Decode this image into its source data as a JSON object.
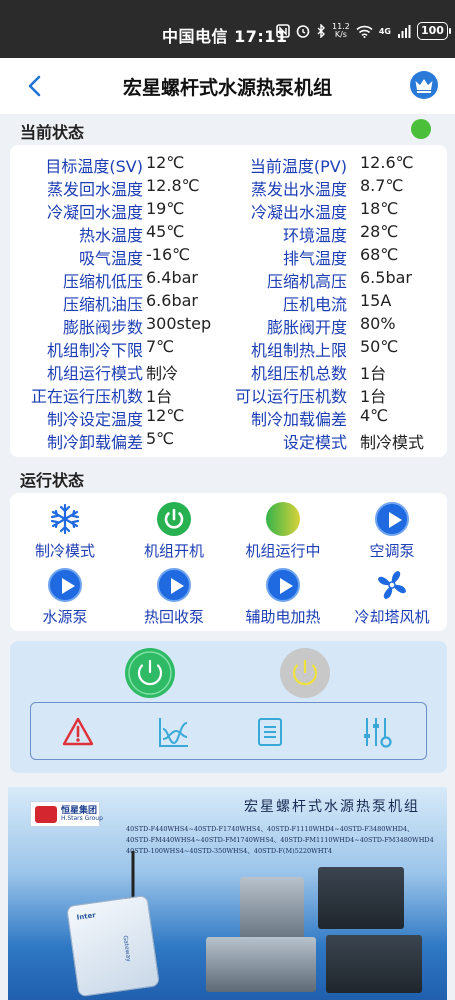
{
  "status_bar": {
    "carrier_time": "中国电信 17:11",
    "net_speed_value": "11.2",
    "net_speed_unit": "K/s",
    "network": "4G",
    "battery": "100"
  },
  "header": {
    "title": "宏星螺杆式水源热泵机组",
    "back_icon": "chevron-left-icon",
    "crown_icon": "crown-icon"
  },
  "current_state": {
    "heading": "当前状态",
    "indicator_color": "#4cbf3a",
    "rows": [
      {
        "l1": "目标温度(SV)",
        "v1": "12℃",
        "l2": "当前温度(PV)",
        "v2": "12.6℃"
      },
      {
        "l1": "蒸发回水温度",
        "v1": "12.8℃",
        "l2": "蒸发出水温度",
        "v2": "8.7℃"
      },
      {
        "l1": "冷凝回水温度",
        "v1": "19℃",
        "l2": "冷凝出水温度",
        "v2": "18℃"
      },
      {
        "l1": "热水温度",
        "v1": "45℃",
        "l2": "环境温度",
        "v2": "28℃"
      },
      {
        "l1": "吸气温度",
        "v1": "-16℃",
        "l2": "排气温度",
        "v2": "68℃"
      },
      {
        "l1": "压缩机低压",
        "v1": "6.4bar",
        "l2": "压缩机高压",
        "v2": "6.5bar"
      },
      {
        "l1": "压缩机油压",
        "v1": "6.6bar",
        "l2": "压机电流",
        "v2": "15A"
      },
      {
        "l1": "膨胀阀步数",
        "v1": "300step",
        "l2": "膨胀阀开度",
        "v2": "80%"
      },
      {
        "l1": "机组制冷下限",
        "v1": "7℃",
        "l2": "机组制热上限",
        "v2": "50℃"
      },
      {
        "l1": "机组运行模式",
        "v1": "制冷",
        "l2": "机组压机总数",
        "v2": "1台"
      },
      {
        "l1": "正在运行压机数",
        "v1": "1台",
        "l2": "可以运行压机数",
        "v2": "1台"
      },
      {
        "l1": "制冷设定温度",
        "v1": "12℃",
        "l2": "制冷加载偏差",
        "v2": "4℃"
      },
      {
        "l1": "制冷卸载偏差",
        "v1": "5℃",
        "l2": "设定模式",
        "v2": "制冷模式"
      }
    ]
  },
  "running_state": {
    "heading": "运行状态",
    "items": [
      {
        "label": "制冷模式",
        "icon": "snowflake-icon"
      },
      {
        "label": "机组开机",
        "icon": "power-on-icon"
      },
      {
        "label": "机组运行中",
        "icon": "running-indicator-icon"
      },
      {
        "label": "空调泵",
        "icon": "play-icon"
      },
      {
        "label": "水源泵",
        "icon": "play-icon"
      },
      {
        "label": "热回收泵",
        "icon": "play-icon"
      },
      {
        "label": "辅助电加热",
        "icon": "play-icon"
      },
      {
        "label": "冷却塔风机",
        "icon": "fan-icon"
      }
    ]
  },
  "controls": {
    "power_on_icon": "power-on-button-icon",
    "power_off_icon": "power-off-button-icon",
    "tools": [
      "alarm-icon",
      "trend-chart-icon",
      "list-icon",
      "settings-sliders-icon"
    ]
  },
  "banner": {
    "logo_cn": "恒星集团",
    "logo_en": "H.Stars Group",
    "title": "宏星螺杆式水源热泵机组",
    "models": [
      "40STD-F440WHS4~40STD-F1740WHS4、40STD-F1110WHD4~40STD-F3480WHD4、",
      "40STD-FM440WHS4~40STD-FM1740WHS4、40STD-FM1110WHD4~40STD-FM3480WHD4",
      "40STD-100WHS4~40STD-350WHS4、40STD-F(M)5220WHT4"
    ],
    "gateway_label": "Gateway",
    "gateway_brand": "Inter"
  },
  "colors": {
    "label_blue": "#1d3fb5",
    "status_green": "#4cbf3a",
    "accent_blue": "#2979d8"
  }
}
